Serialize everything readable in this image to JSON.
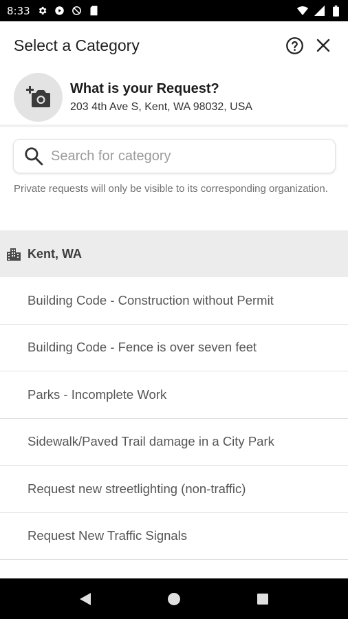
{
  "status_bar": {
    "time": "8:33",
    "left_icons": [
      "gear-icon",
      "play-icon",
      "no-sim-icon",
      "sd-card-icon"
    ],
    "right_icons": [
      "wifi-icon",
      "signal-icon",
      "battery-icon"
    ]
  },
  "header": {
    "title": "Select a Category",
    "help_icon": "help-circle-icon",
    "close_icon": "close-icon"
  },
  "request": {
    "title": "What is your Request?",
    "address": "203 4th Ave S, Kent, WA 98032, USA",
    "photo_icon": "add-photo-icon"
  },
  "search": {
    "placeholder": "Search for category",
    "value": ""
  },
  "privacy_note": "Private requests will only be visible to its corresponding organization.",
  "organization": {
    "name": "Kent, WA",
    "icon": "city-building-icon"
  },
  "categories": [
    "Building Code - Construction without Permit",
    "Building Code - Fence is over seven feet",
    "Parks - Incomplete Work",
    "Sidewalk/Paved Trail damage in a City Park",
    "Request new streetlighting (non-traffic)",
    "Request New Traffic Signals"
  ],
  "nav_bar": {
    "buttons": [
      "back-icon",
      "home-icon",
      "recents-icon"
    ]
  },
  "colors": {
    "status_bar": "#000000",
    "org_header_bg": "#ececec",
    "photo_circle": "#e3e3e3",
    "divider": "#e0e0e0"
  }
}
